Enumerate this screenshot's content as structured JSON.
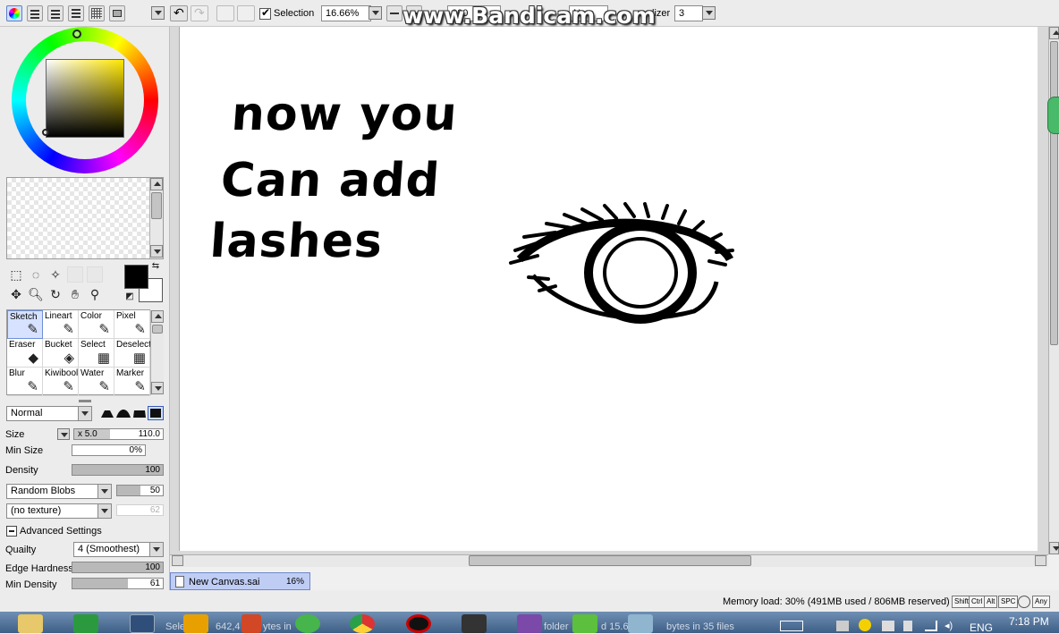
{
  "watermark": "www.Bandicam.com",
  "toolbar": {
    "selection_label": "Selection",
    "selection_checked": true,
    "zoom": "16.66%",
    "partial_blend": "Nor",
    "partial_zoom": "000",
    "stabilizer_label": "lizer",
    "stabilizer_value": "3"
  },
  "brushes": [
    {
      "label": "Sketch",
      "glyph": "✎",
      "active": true
    },
    {
      "label": "Lineart",
      "glyph": "✎"
    },
    {
      "label": "Color",
      "glyph": "✎"
    },
    {
      "label": "Pixel",
      "glyph": "✎"
    },
    {
      "label": "Eraser",
      "glyph": "◆"
    },
    {
      "label": "Bucket",
      "glyph": "◈"
    },
    {
      "label": "Select",
      "glyph": "▦"
    },
    {
      "label": "Deselect",
      "glyph": "▦"
    },
    {
      "label": "Blur",
      "glyph": "✎"
    },
    {
      "label": "Kiwibool",
      "glyph": "✎"
    },
    {
      "label": "Water",
      "glyph": "✎"
    },
    {
      "label": "Marker",
      "glyph": "✎"
    }
  ],
  "brush_settings": {
    "blend_mode": "Normal",
    "size_label": "Size",
    "size_multiplier": "x 5.0",
    "size_value": "110.0",
    "min_size_label": "Min Size",
    "min_size_value": "0%",
    "density_label": "Density",
    "density_value": "100",
    "density_level": 1.0,
    "shape": "Random Blobs",
    "shape_value": "50",
    "shape_level": 0.5,
    "texture": "(no texture)",
    "texture_value": "62",
    "advanced_label": "Advanced Settings",
    "quality_label": "Quailty",
    "quality_value": "4 (Smoothest)",
    "edge_label": "Edge Hardness",
    "edge_value": "100",
    "edge_level": 1.0,
    "min_density_label": "Min Density",
    "min_density_value": "61",
    "min_density_level": 0.61
  },
  "canvas": {
    "text_line1": "now you",
    "text_line2": "Can add",
    "text_line3": "lashes"
  },
  "document_tab": {
    "name": "New Canvas.sai",
    "zoom": "16%"
  },
  "status": {
    "memory": "Memory load: 30% (491MB used / 806MB reserved)",
    "keys": [
      "Shift",
      "Ctrl",
      "Alt",
      "SPC",
      "Any"
    ]
  },
  "taskbar": {
    "faded_left": "Sele",
    "faded_bytes": "642,4",
    "faded_bytes2": "ytes in",
    "faded_right": "bytes in 35 files",
    "faded_mid": "folder",
    "faded_mid2": "d 15.6",
    "lang": "ENG",
    "time": "7:18 PM"
  },
  "colors": {
    "foreground": "#000000",
    "background": "#ffffff",
    "tab_bg": "#bfcdf5"
  }
}
